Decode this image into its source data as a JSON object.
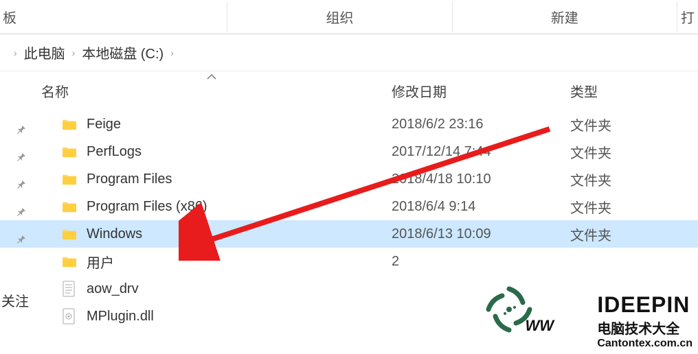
{
  "ribbon": {
    "group1": "板",
    "group2": "组织",
    "group3": "新建",
    "group4": "打"
  },
  "breadcrumb": {
    "item1": "此电脑",
    "item2": "本地磁盘 (C:)"
  },
  "columns": {
    "name": "名称",
    "date": "修改日期",
    "type": "类型"
  },
  "files": [
    {
      "name": "Feige",
      "date": "2018/6/2 23:16",
      "type": "文件夹",
      "kind": "folder",
      "pinned": true
    },
    {
      "name": "PerfLogs",
      "date": "2017/12/14 7:44",
      "type": "文件夹",
      "kind": "folder",
      "pinned": true
    },
    {
      "name": "Program Files",
      "date": "2018/4/18 10:10",
      "type": "文件夹",
      "kind": "folder",
      "pinned": true
    },
    {
      "name": "Program Files (x86)",
      "date": "2018/6/4 9:14",
      "type": "文件夹",
      "kind": "folder",
      "pinned": true
    },
    {
      "name": "Windows",
      "date": "2018/6/13 10:09",
      "type": "文件夹",
      "kind": "folder",
      "selected": true
    },
    {
      "name": "用户",
      "date": "2",
      "type": "",
      "kind": "folder"
    },
    {
      "name": "aow_drv",
      "date": "",
      "type": "",
      "kind": "textfile"
    },
    {
      "name": "MPlugin.dll",
      "date": "",
      "type": "",
      "kind": "dllfile"
    }
  ],
  "side_label": "关注",
  "watermark": {
    "logo": "IDEEPIN",
    "subtitle": "电脑技术大全",
    "url": "Cantontex.com.cn",
    "ww": "WW"
  }
}
